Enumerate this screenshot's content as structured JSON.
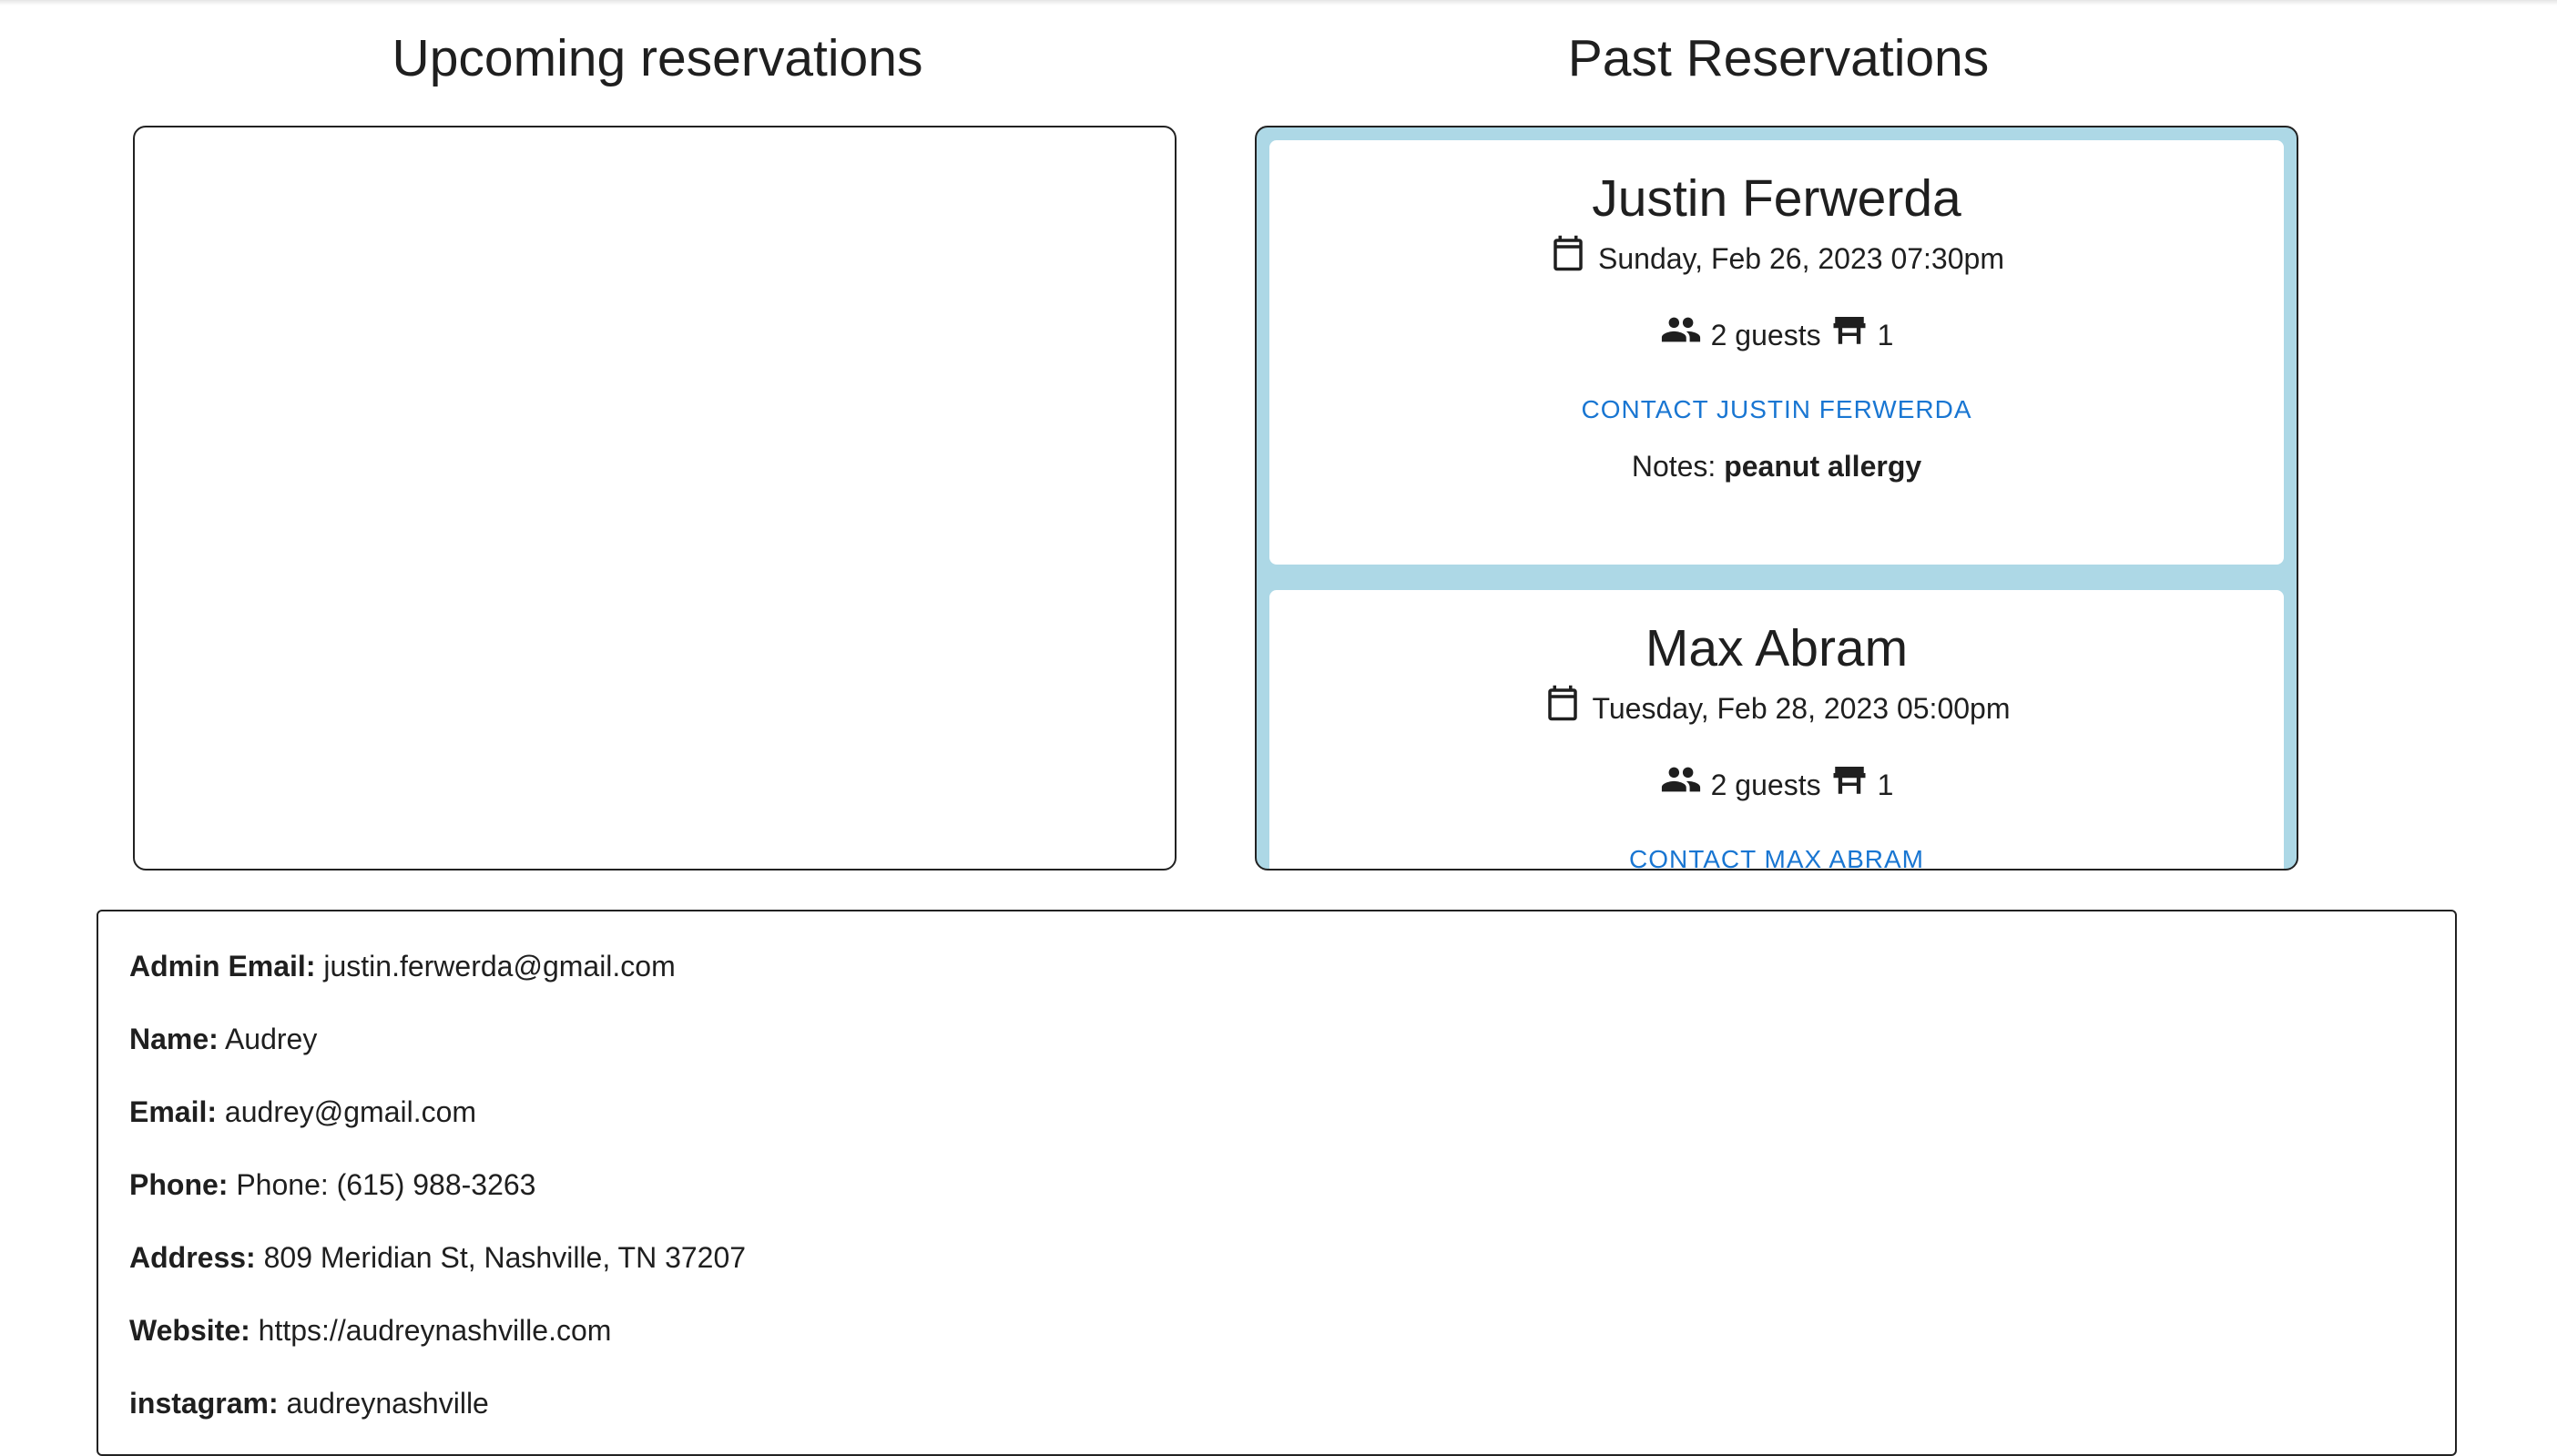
{
  "titles": {
    "upcoming": "Upcoming reservations",
    "past": "Past Reservations"
  },
  "past_reservations": [
    {
      "name": "Justin Ferwerda",
      "date": "Sunday, Feb 26, 2023 07:30pm",
      "guests": "2 guests",
      "tables": "1",
      "contact": "CONTACT JUSTIN FERWERDA",
      "notes_label": "Notes:",
      "notes": "peanut allergy"
    },
    {
      "name": "Max Abram",
      "date": "Tuesday, Feb 28, 2023 05:00pm",
      "guests": "2 guests",
      "tables": "1",
      "contact": "CONTACT MAX ABRAM"
    }
  ],
  "info": {
    "admin_email_label": "Admin Email:",
    "admin_email": "justin.ferwerda@gmail.com",
    "name_label": "Name:",
    "name": "Audrey",
    "email_label": "Email:",
    "email": "audrey@gmail.com",
    "phone_label": "Phone:",
    "phone": "Phone: (615) 988-3263",
    "address_label": "Address:",
    "address": "809 Meridian St, Nashville, TN 37207",
    "website_label": "Website:",
    "website": "https://audreynashville.com",
    "instagram_label": "instagram:",
    "instagram": "audreynashville"
  },
  "colors": {
    "past_panel_bg": "#add8e6",
    "link": "#1976d2"
  },
  "icons": {
    "date": "calendar-icon",
    "guests": "people-icon",
    "table": "table-icon"
  }
}
